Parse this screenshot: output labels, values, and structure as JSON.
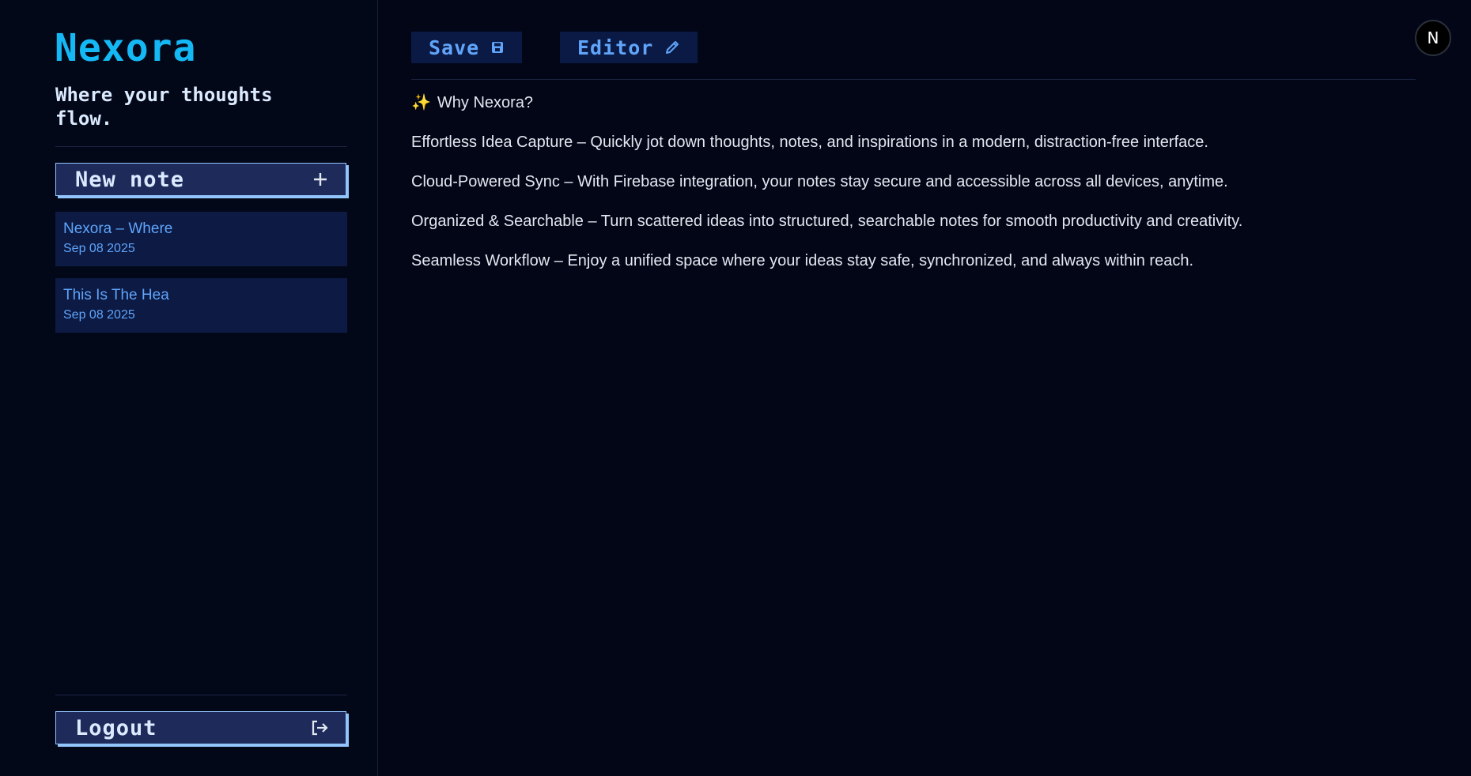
{
  "sidebar": {
    "brand": "Nexora",
    "tagline": "Where your thoughts flow.",
    "new_note_label": "New note",
    "notes": [
      {
        "title": "Nexora – Where",
        "date": "Sep 08 2025"
      },
      {
        "title": "This Is The Hea",
        "date": "Sep 08 2025"
      }
    ],
    "logout_label": "Logout"
  },
  "toolbar": {
    "save_label": "Save",
    "editor_label": "Editor"
  },
  "avatar": {
    "initial": "N"
  },
  "content": {
    "heading_emoji": "✨",
    "heading": "Why Nexora?",
    "paragraphs": [
      "Effortless Idea Capture – Quickly jot down thoughts, notes, and inspirations in a modern, distraction-free interface.",
      "Cloud-Powered Sync – With Firebase integration, your notes stay secure and accessible across all devices, anytime.",
      "Organized & Searchable – Turn scattered ideas into structured, searchable notes for smooth productivity and creativity.",
      "Seamless Workflow – Enjoy a unified space where your ideas stay safe, synchronized, and always within reach."
    ]
  },
  "colors": {
    "background": "#020617",
    "brand": "#14b8f5",
    "accent": "#60a5fa",
    "button_border": "#93c5fd"
  },
  "icons": {
    "new_note": "plus-icon",
    "logout": "logout-icon",
    "save": "floppy-disk-icon",
    "editor": "pencil-icon",
    "heading": "sparkles-icon"
  }
}
